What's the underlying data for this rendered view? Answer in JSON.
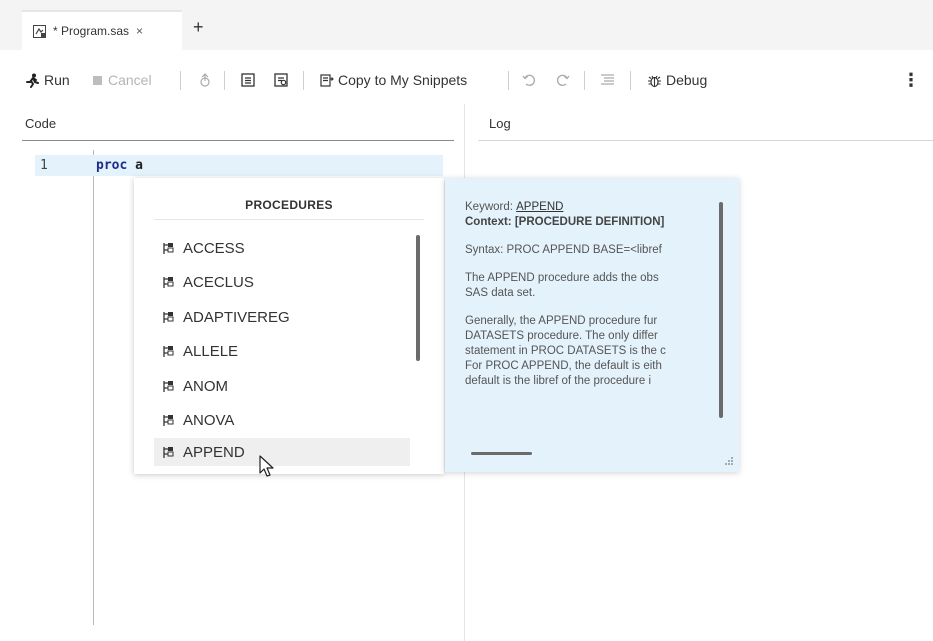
{
  "tabs": [
    {
      "title": "* Program.sas",
      "close": "×",
      "icon": "program-file-icon"
    }
  ],
  "add_tab": "+",
  "toolbar": {
    "run": "Run",
    "cancel": "Cancel",
    "copy_snippets": "Copy to My Snippets",
    "debug": "Debug",
    "more": "⋮"
  },
  "code_pane": {
    "label": "Code",
    "line_number": "1",
    "keyword": "proc",
    "typed": "a"
  },
  "log_pane": {
    "label": "Log"
  },
  "autocomplete": {
    "header": "PROCEDURES",
    "items": [
      "ACCESS",
      "ACECLUS",
      "ADAPTIVEREG",
      "ALLELE",
      "ANOM",
      "ANOVA",
      "APPEND"
    ],
    "selected": "APPEND"
  },
  "doc_popup": {
    "keyword_label": "Keyword:",
    "keyword": "APPEND",
    "context": "Context: [PROCEDURE DEFINITION]",
    "syntax": "Syntax: PROC APPEND BASE=<libref",
    "desc_line1": "The APPEND procedure adds the obs",
    "desc_line2": "SAS data set.",
    "gen_line1": "Generally, the APPEND procedure fur",
    "gen_line2": "DATASETS procedure. The only differ",
    "gen_line3": "statement in PROC DATASETS is the c",
    "gen_line4": "For PROC APPEND, the default is eith",
    "gen_line5": "default is the libref of the procedure i"
  },
  "colors": {
    "keyword": "#1e2c8a",
    "line_highlight": "#e3f2fb",
    "doc_bg": "#e4f2fb",
    "tabstrip_bg": "#f4f4f4"
  }
}
